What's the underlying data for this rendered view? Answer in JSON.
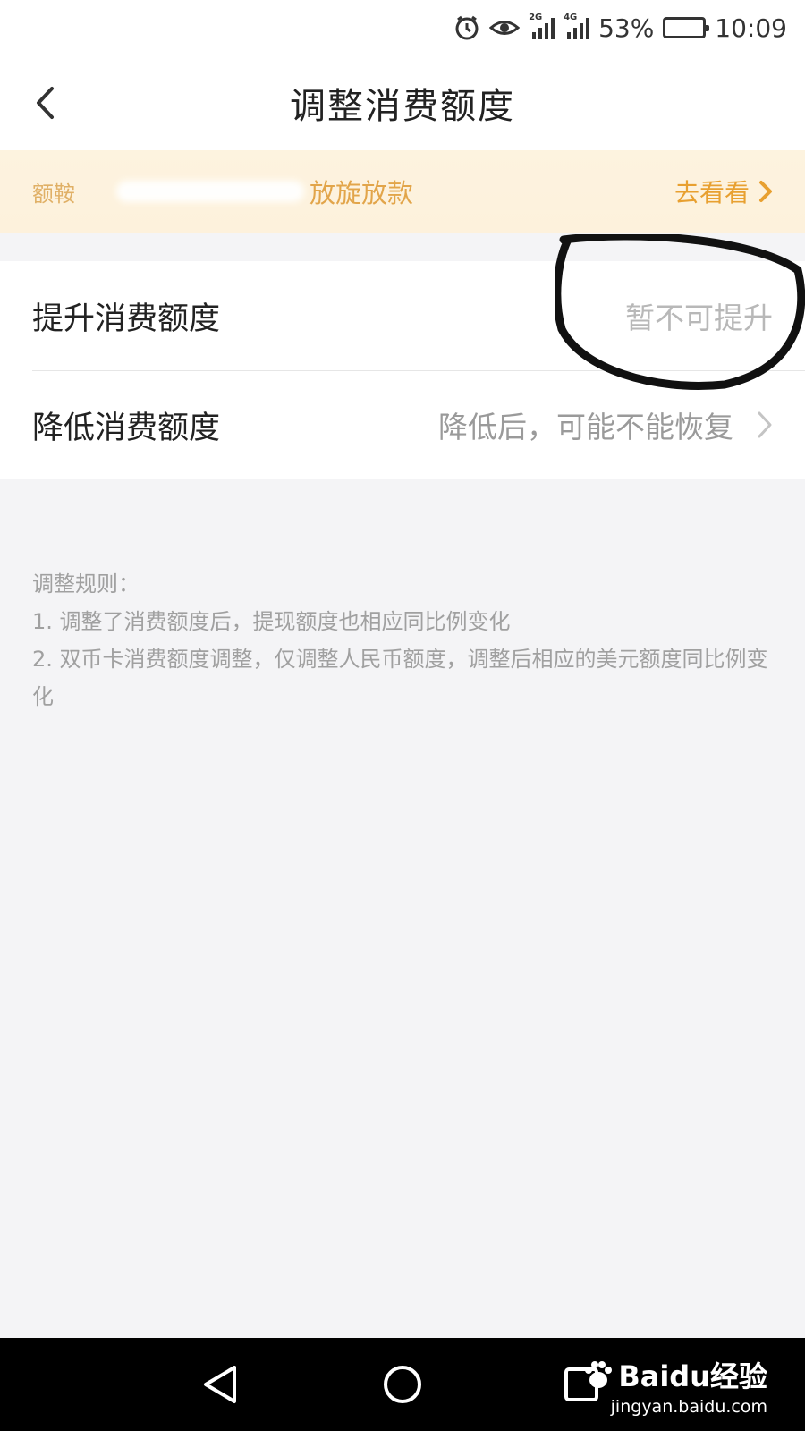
{
  "status_bar": {
    "battery_percent_label": "53%",
    "battery_level": 0.53,
    "time": "10:09",
    "network_1": "2G",
    "network_2": "4G",
    "icons": [
      "alarm-icon",
      "eye-icon",
      "signal-icon",
      "signal-icon",
      "battery-icon"
    ]
  },
  "header": {
    "title": "调整消费额度"
  },
  "banner": {
    "left_label": "额鞍",
    "center_text": "放旋放款",
    "action_label": "去看看"
  },
  "options": [
    {
      "label": "提升消费额度",
      "value": "暂不可提升"
    },
    {
      "label": "降低消费额度",
      "value": "降低后，可能不能恢复"
    }
  ],
  "rules": {
    "heading": "调整规则：",
    "lines": [
      "1. 调整了消费额度后，提现额度也相应同比例变化",
      "2. 双币卡消费额度调整，仅调整人民币额度，调整后相应的美元额度同比例变化"
    ]
  },
  "watermark": {
    "brand": "Baidu经验",
    "url": "jingyan.baidu.com"
  },
  "colors": {
    "accent": "#e8a030",
    "banner_bg": "#fdf2dd",
    "page_bg": "#f4f4f6",
    "muted_text": "#a0a0a0"
  }
}
